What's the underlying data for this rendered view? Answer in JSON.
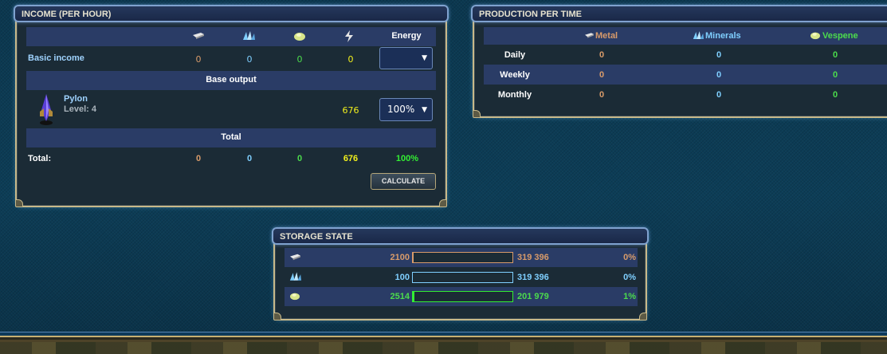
{
  "income": {
    "title": "INCOME (PER HOUR)",
    "header": {
      "energy": "Energy"
    },
    "icons": {
      "metal": "metal-bar-icon",
      "crystal": "crystal-icon",
      "deuterium": "vespene-icon",
      "energy": "lightning-icon"
    },
    "basic_income": {
      "label": "Basic income",
      "metal": "0",
      "crystal": "0",
      "deuterium": "0",
      "energy": "0",
      "select_value": ""
    },
    "base_output_label": "Base output",
    "pylon": {
      "name": "Pylon",
      "level": "Level: 4",
      "energy": "676",
      "select_value": "100%"
    },
    "total_label": "Total",
    "totals": {
      "label": "Total:",
      "metal": "0",
      "crystal": "0",
      "deuterium": "0",
      "energy": "676",
      "percent": "100%"
    },
    "calculate_label": "CALCULATE"
  },
  "production": {
    "title": "PRODUCTION PER TIME",
    "headers": {
      "metal": "Metal",
      "crystal": "Minerals",
      "deuterium": "Vespene"
    },
    "rows": [
      {
        "label": "Daily",
        "metal": "0",
        "crystal": "0",
        "deuterium": "0"
      },
      {
        "label": "Weekly",
        "metal": "0",
        "crystal": "0",
        "deuterium": "0"
      },
      {
        "label": "Monthly",
        "metal": "0",
        "crystal": "0",
        "deuterium": "0"
      }
    ]
  },
  "storage": {
    "title": "STORAGE STATE",
    "rows": [
      {
        "resource": "metal",
        "amount": "2100",
        "capacity": "319 396",
        "percent": "0%",
        "fill": 0.0066,
        "color": "#d89b6a"
      },
      {
        "resource": "crystal",
        "amount": "100",
        "capacity": "319 396",
        "percent": "0%",
        "fill": 0.0003,
        "color": "#7fcfff"
      },
      {
        "resource": "deuterium",
        "amount": "2514",
        "capacity": "201 979",
        "percent": "1%",
        "fill": 0.0124,
        "color": "#33ee33"
      }
    ]
  },
  "colors": {
    "metal": "#d89b6a",
    "crystal": "#7fcfff",
    "deuterium": "#4cdc4c",
    "energy": "#f2f01c",
    "header_bg": "#2a3c66"
  }
}
